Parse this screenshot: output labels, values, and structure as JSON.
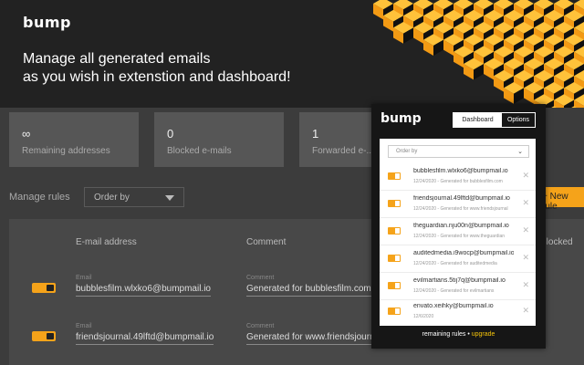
{
  "hero": {
    "logo": "bump",
    "tagline_line1": "Manage all generated emails",
    "tagline_line2": "as you wish in extenstion and dashboard!"
  },
  "dashboard": {
    "stats": [
      {
        "value": "∞",
        "label": "Remaining addresses"
      },
      {
        "value": "0",
        "label": "Blocked e-mails"
      },
      {
        "value": "1",
        "label": "Forwarded e-..."
      }
    ],
    "manage_rules_label": "Manage rules",
    "order_by": "Order by",
    "new_rule": "+ New rule",
    "columns": {
      "email": "E-mail address",
      "comment": "Comment",
      "blocked": "Blocked"
    },
    "rows": [
      {
        "email_caption": "Email",
        "email": "bubblesfilm.wlxko6@bumpmail.io",
        "comment_caption": "Comment",
        "comment": "Generated for bubblesfilm.com"
      },
      {
        "email_caption": "Email",
        "email": "friendsjournal.49lftd@bumpmail.io",
        "comment_caption": "Comment",
        "comment": "Generated for www.friendsjournal"
      }
    ]
  },
  "popup": {
    "logo": "bump",
    "tab_dashboard": "Dashboard",
    "tab_options": "Options",
    "order_by": "Order by",
    "items": [
      {
        "email": "bubblesfilm.wlxko6@bumpmail.io",
        "meta": "12/24/2020 - Generated for bubblesfilm.com"
      },
      {
        "email": "friendsjournal.49lftd@bumpmail.io",
        "meta": "12/24/2020 - Generated for www.friendsjournal"
      },
      {
        "email": "theguardian.nju00n@bumpmail.io",
        "meta": "12/24/2020 - Generated for www.theguardian"
      },
      {
        "email": "auditedmedia.i9wocp@bumpmail.io",
        "meta": "12/24/2020 - Generated for auditedmedia"
      },
      {
        "email": "evilmartians.5tij7q@bumpmail.io",
        "meta": "12/24/2020 - Generated for evilmartians"
      },
      {
        "email": "envato.xeihky@bumpmail.io",
        "meta": "12/6/2020"
      }
    ],
    "remaining_rules": "remaining rules",
    "separator": "•",
    "upgrade": "upgrade"
  },
  "colors": {
    "accent": "#f5a31a",
    "background": "#222222",
    "panel": "#3c3c3c"
  }
}
